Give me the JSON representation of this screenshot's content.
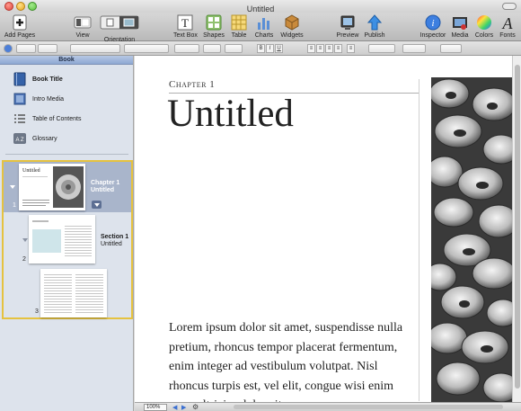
{
  "window": {
    "title": "Untitled"
  },
  "toolbar": {
    "add_pages": "Add Pages",
    "view": "View",
    "orientation": "Orientation",
    "text_box": "Text Box",
    "shapes": "Shapes",
    "table": "Table",
    "charts": "Charts",
    "widgets": "Widgets",
    "preview": "Preview",
    "publish": "Publish",
    "inspector": "Inspector",
    "media": "Media",
    "colors": "Colors",
    "fonts": "Fonts"
  },
  "formatbar": {
    "bold": "B",
    "italic": "I",
    "underline": "U"
  },
  "sidebar": {
    "header": "Book",
    "items": [
      {
        "label": "Book Title",
        "icon": "book-icon"
      },
      {
        "label": "Intro Media",
        "icon": "media-icon"
      },
      {
        "label": "Table of Contents",
        "icon": "list-icon"
      },
      {
        "label": "Glossary",
        "icon": "glossary-icon"
      }
    ],
    "glossary_icon_text": "A Z",
    "chapter": {
      "number": "1",
      "line1": "Chapter 1",
      "line2": "Untitled",
      "thumb_title": "Untitled"
    },
    "section": {
      "number": "2",
      "line1": "Section 1",
      "line2": "Untitled"
    },
    "page3": {
      "number": "3"
    }
  },
  "document": {
    "chapter_label": "Chapter 1",
    "title": "Untitled",
    "body": "Lorem ipsum dolor sit amet, suspendisse nulla pretium, rhoncus tempor placerat fermentum, enim integer ad vestibulum volutpat. Nisl rhoncus turpis est, vel elit, congue wisi enim nunc ultricies dolor sit."
  },
  "statusbar": {
    "zoom": "100%"
  },
  "colors": {
    "selection_border": "#e5c240",
    "sidebar_bg": "#dde3ec",
    "chapter_row": "#a9b5cb"
  }
}
